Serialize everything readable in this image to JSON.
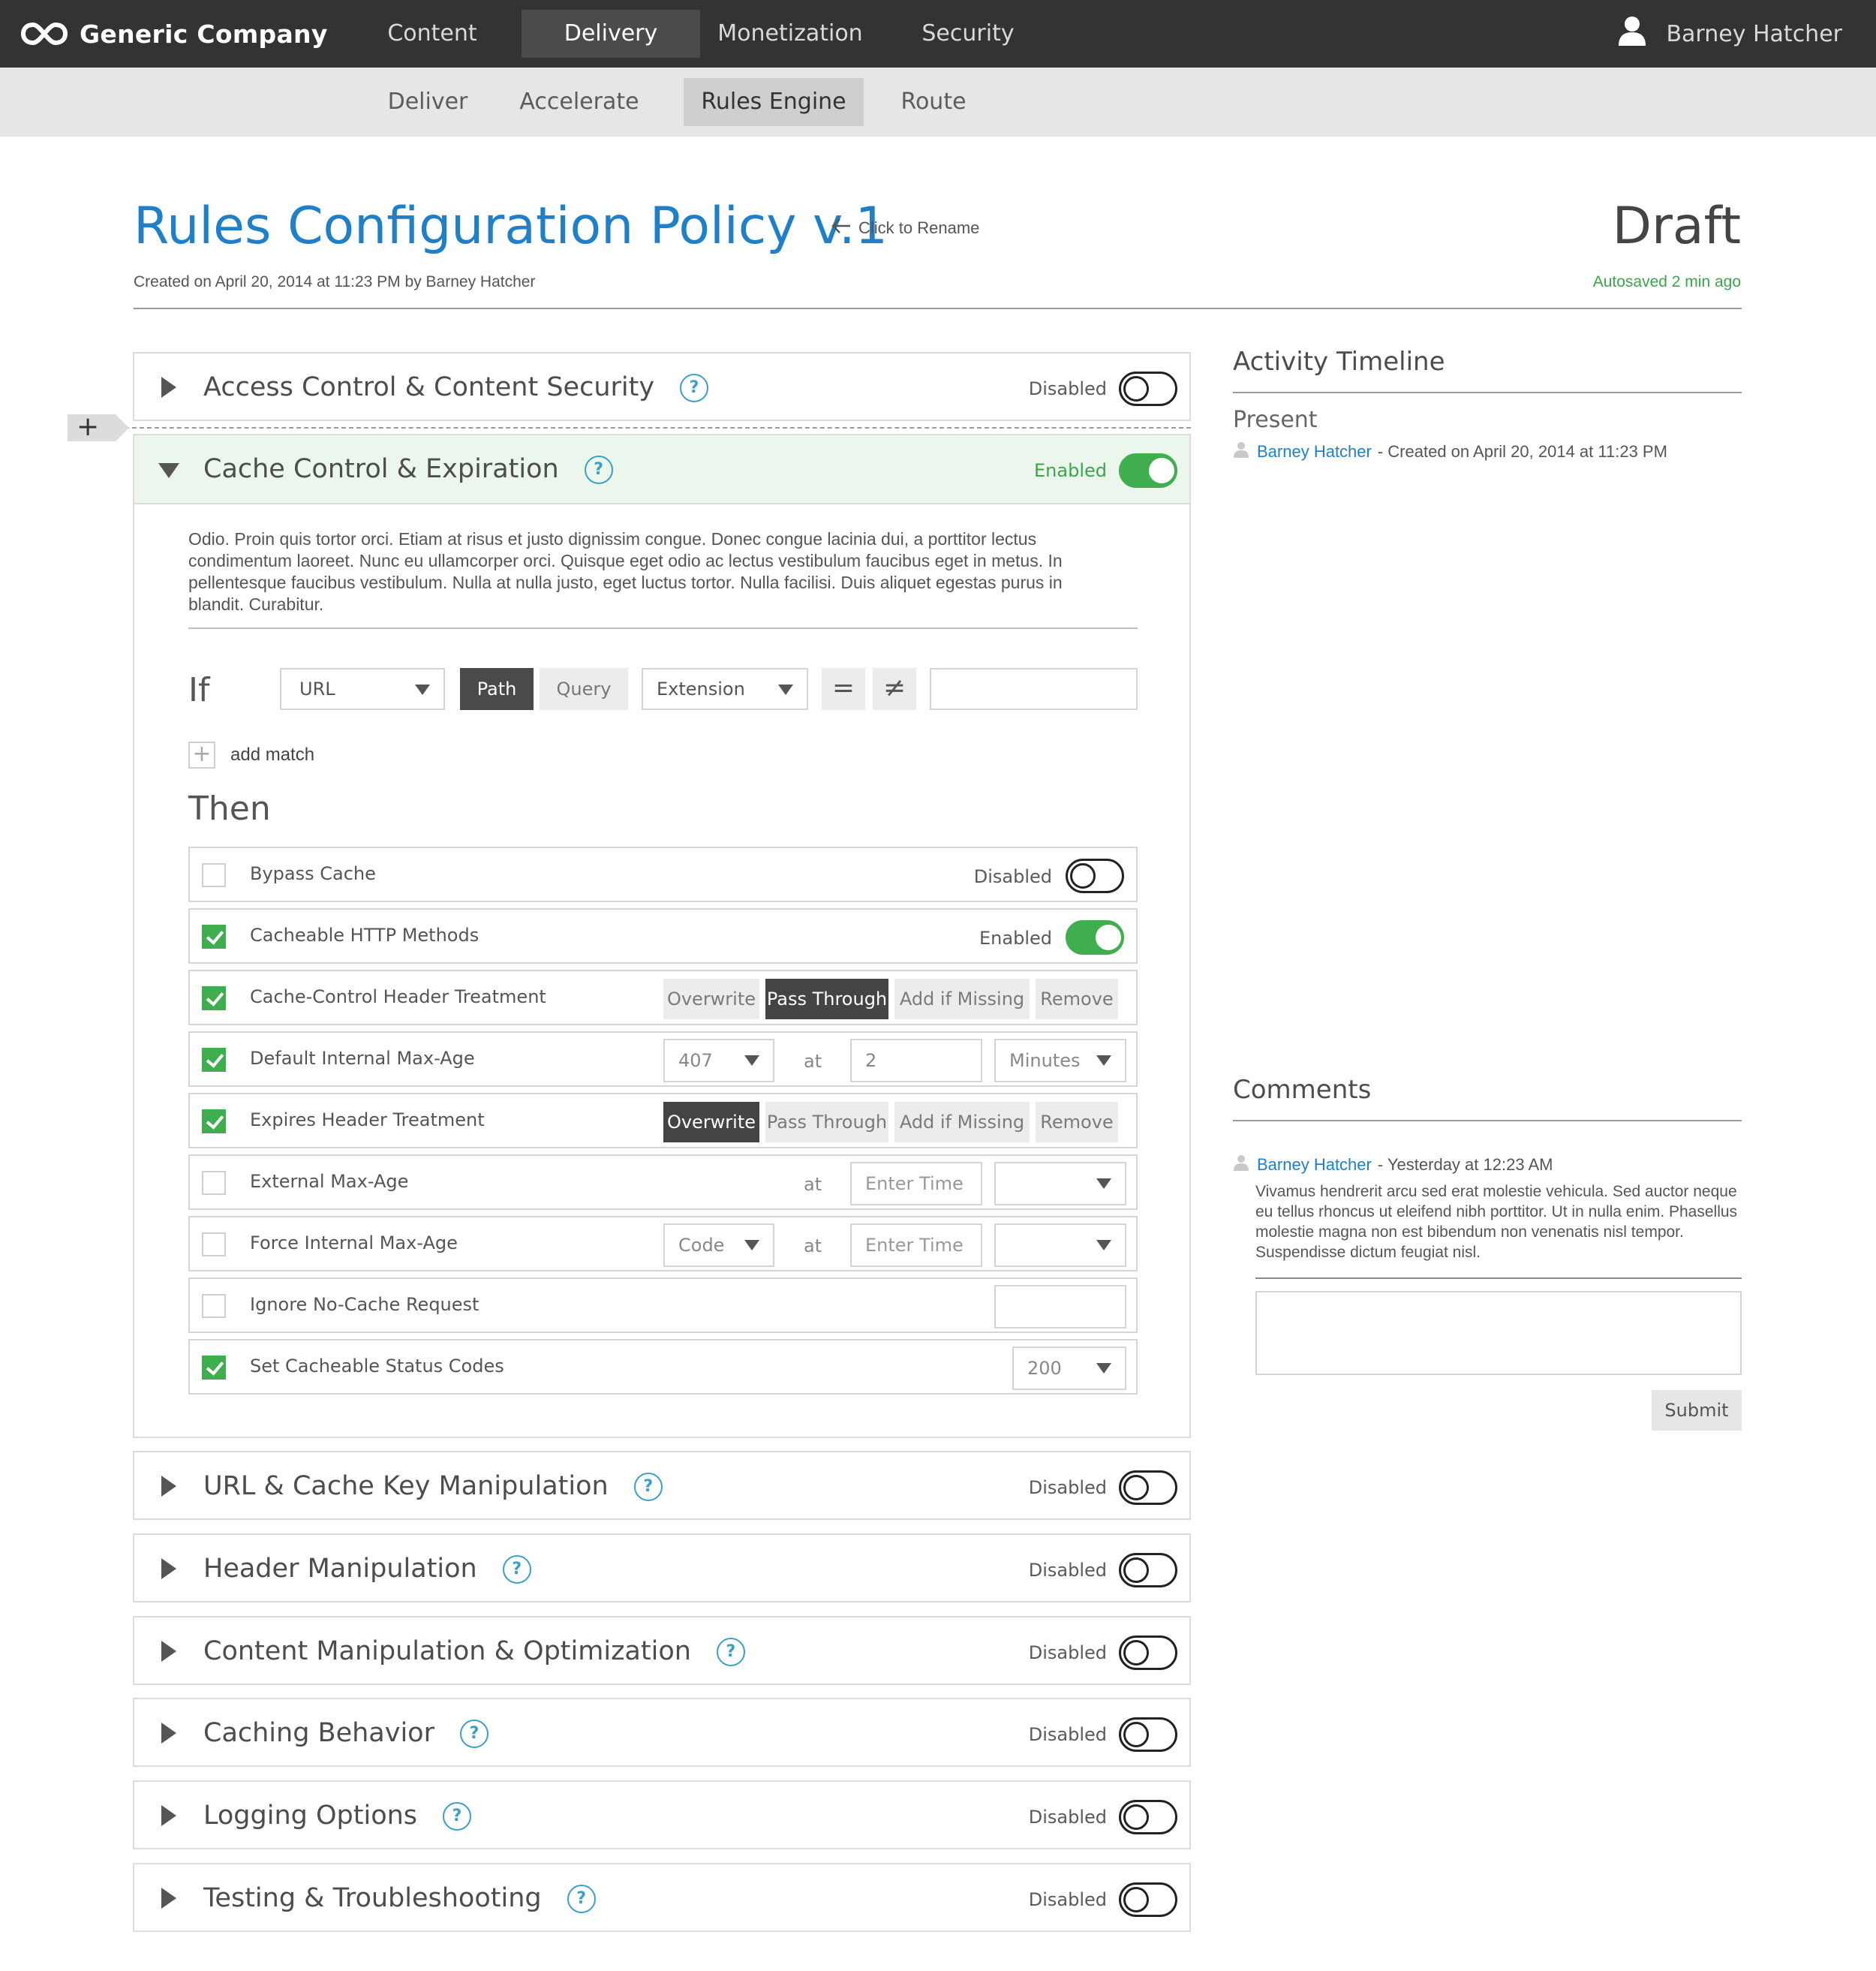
{
  "brand": {
    "name": "Generic Company"
  },
  "top_nav": [
    {
      "label": "Content"
    },
    {
      "label": "Delivery",
      "active": true
    },
    {
      "label": "Monetization"
    },
    {
      "label": "Security"
    }
  ],
  "user": {
    "name": "Barney Hatcher",
    "icon": "user-icon"
  },
  "sub_nav": [
    {
      "label": "Deliver"
    },
    {
      "label": "Accelerate"
    },
    {
      "label": "Rules Engine",
      "active": true
    },
    {
      "label": "Route"
    }
  ],
  "policy": {
    "title": "Rules Configuration Policy v.1",
    "rename_hint": "Click to Rename",
    "created": "Created on April 20, 2014 at 11:23 PM by Barney Hatcher",
    "status": "Draft",
    "autosaved": "Autosaved 2 min ago"
  },
  "colors": {
    "accent": "#1f7fc8",
    "success": "#3fae4f",
    "topbar": "#333333",
    "help": "#3aa0c8"
  },
  "sections": [
    {
      "title": "Access Control & Content Security",
      "state": "Disabled",
      "enabled": false
    },
    {
      "title": "Cache Control & Expiration",
      "state": "Enabled",
      "enabled": true,
      "expanded": true
    },
    {
      "title": "URL & Cache Key Manipulation",
      "state": "Disabled",
      "enabled": false
    },
    {
      "title": "Header Manipulation",
      "state": "Disabled",
      "enabled": false
    },
    {
      "title": "Content Manipulation & Optimization",
      "state": "Disabled",
      "enabled": false
    },
    {
      "title": "Caching Behavior",
      "state": "Disabled",
      "enabled": false
    },
    {
      "title": "Logging Options",
      "state": "Disabled",
      "enabled": false
    },
    {
      "title": "Testing & Troubleshooting",
      "state": "Disabled",
      "enabled": false
    }
  ],
  "help_glyph": "?",
  "add_rule_glyph": "+",
  "cache_control": {
    "description": "Odio. Proin quis tortor orci. Etiam at risus et justo dignissim congue. Donec congue lacinia dui, a porttitor lectus condimentum laoreet. Nunc eu ullamcorper orci. Quisque eget odio ac lectus vestibulum faucibus eget in metus. In pellentesque faucibus vestibulum. Nulla at nulla justo, eget luctus tortor. Nulla facilisi. Duis aliquet egestas purus in blandit. Curabitur.",
    "if_label": "If",
    "match": {
      "field": "URL",
      "path": "Path",
      "query": "Query",
      "type": "Extension",
      "equals": "=",
      "not_equals": "≠",
      "value": ""
    },
    "add_match_glyph": "+",
    "add_match": "add match",
    "then_label": "Then",
    "rules": {
      "bypass_cache": {
        "label": "Bypass Cache",
        "checked": false,
        "state": "Disabled"
      },
      "cacheable_methods": {
        "label": "Cacheable HTTP Methods",
        "checked": true,
        "state": "Enabled"
      },
      "cc_header": {
        "label": "Cache-Control Header Treatment",
        "checked": true,
        "options": [
          "Overwrite",
          "Pass Through",
          "Add if Missing",
          "Remove"
        ],
        "selected": "Pass Through"
      },
      "default_max_age": {
        "label": "Default Internal Max-Age",
        "checked": true,
        "code": "407",
        "at": "at",
        "time": "2",
        "unit": "Minutes"
      },
      "expires_header": {
        "label": "Expires Header Treatment",
        "checked": true,
        "options": [
          "Overwrite",
          "Pass Through",
          "Add if Missing",
          "Remove"
        ],
        "selected": "Overwrite"
      },
      "external_max_age": {
        "label": "External Max-Age",
        "checked": false,
        "at": "at",
        "time_placeholder": "Enter Time",
        "unit": ""
      },
      "force_max_age": {
        "label": "Force Internal Max-Age",
        "checked": false,
        "code": "Code",
        "at": "at",
        "time_placeholder": "Enter Time",
        "unit": ""
      },
      "ignore_no_cache": {
        "label": "Ignore No-Cache Request",
        "checked": false,
        "value": ""
      },
      "status_codes": {
        "label": "Set Cacheable Status Codes",
        "checked": true,
        "value": "200"
      }
    }
  },
  "activity": {
    "title": "Activity Timeline",
    "group": "Present",
    "entries": [
      {
        "user": "Barney Hatcher",
        "text": "- Created on April 20, 2014 at 11:23 PM"
      }
    ]
  },
  "comments": {
    "title": "Comments",
    "items": [
      {
        "user": "Barney Hatcher",
        "time": "- Yesterday at 12:23 AM",
        "text": "Vivamus hendrerit arcu sed erat molestie vehicula. Sed auctor neque eu tellus rhoncus ut eleifend nibh porttitor. Ut in nulla enim. Phasellus molestie magna non est bibendum non venenatis nisl tempor. Suspendisse dictum feugiat nisl."
      }
    ],
    "input_value": "",
    "submit_label": "Submit"
  }
}
